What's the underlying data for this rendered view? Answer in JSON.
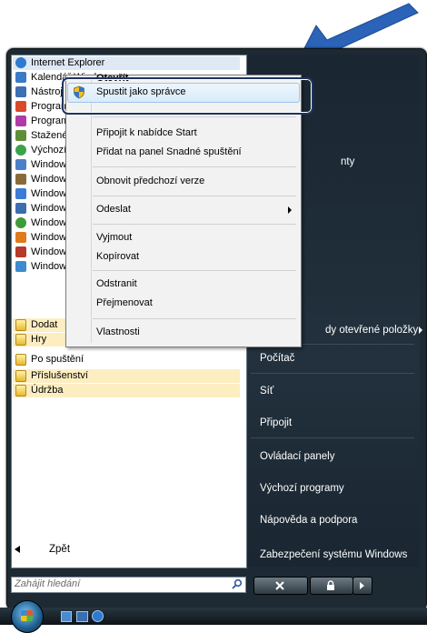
{
  "start_menu": {
    "programs": [
      {
        "label": "Internet Explorer",
        "icon": "internet-explorer-icon",
        "color": "#2f7ad0"
      },
      {
        "label": "Kalendář Windows",
        "icon": "calendar-icon",
        "color": "#3a7bc8"
      },
      {
        "label": "Nástroj",
        "icon": "tool-icon",
        "color": "#3d6fb3"
      },
      {
        "label": "Programy",
        "icon": "program-icon",
        "color": "#d94a2c"
      },
      {
        "label": "Programy",
        "icon": "program-icon-2",
        "color": "#b03aa8"
      },
      {
        "label": "Stažené",
        "icon": "people-icon",
        "color": "#5f8e3b"
      },
      {
        "label": "Výchozí programy",
        "icon": "default-programs-icon",
        "color": "#3aa24a"
      },
      {
        "label": "Windows",
        "icon": "windows-card-icon",
        "color": "#4a80c8"
      },
      {
        "label": "Windows",
        "icon": "windows-contacts-icon",
        "color": "#8a6a3a"
      },
      {
        "label": "Windows",
        "icon": "windows-calendar-icon",
        "color": "#3c7bd8"
      },
      {
        "label": "Windows",
        "icon": "windows-fax-icon",
        "color": "#3a6eb0"
      },
      {
        "label": "Windows",
        "icon": "windows-media-center-icon",
        "color": "#3d9b3a"
      },
      {
        "label": "Windows",
        "icon": "windows-media-player-icon",
        "color": "#e07a1c"
      },
      {
        "label": "Windows",
        "icon": "windows-movie-maker-icon",
        "color": "#b53a2a"
      },
      {
        "label": "Windows",
        "icon": "windows-update-icon",
        "color": "#3d8ad0"
      }
    ],
    "folders": [
      {
        "label": "Dodat",
        "highlight": true
      },
      {
        "label": "Hry",
        "highlight": true
      },
      {
        "label": "Po spuštění",
        "highlight": false
      },
      {
        "label": "Příslušenství",
        "highlight": true
      },
      {
        "label": "Údržba",
        "highlight": true
      }
    ],
    "back_label": "Zpět",
    "search_placeholder": "Zahájit hledání",
    "right": {
      "item_partial": "nty",
      "recent_items": "dy otevřené položky",
      "computer": "Počítač",
      "network": "Síť",
      "connect": "Připojit",
      "control_panel": "Ovládací panely",
      "default_programs": "Výchozí programy",
      "help": "Nápověda a podpora",
      "security": "Zabezpečení systému Windows"
    }
  },
  "context_menu": {
    "open": "Otevřít",
    "run_as_admin": "Spustit jako správce",
    "pin_start": "Připojit k nabídce Start",
    "quick_launch": "Přidat na panel Snadné spuštění",
    "restore": "Obnovit předchozí verze",
    "send_to": "Odeslat",
    "cut": "Vyjmout",
    "copy": "Kopírovat",
    "delete": "Odstranit",
    "rename": "Přejmenovat",
    "properties": "Vlastnosti"
  }
}
